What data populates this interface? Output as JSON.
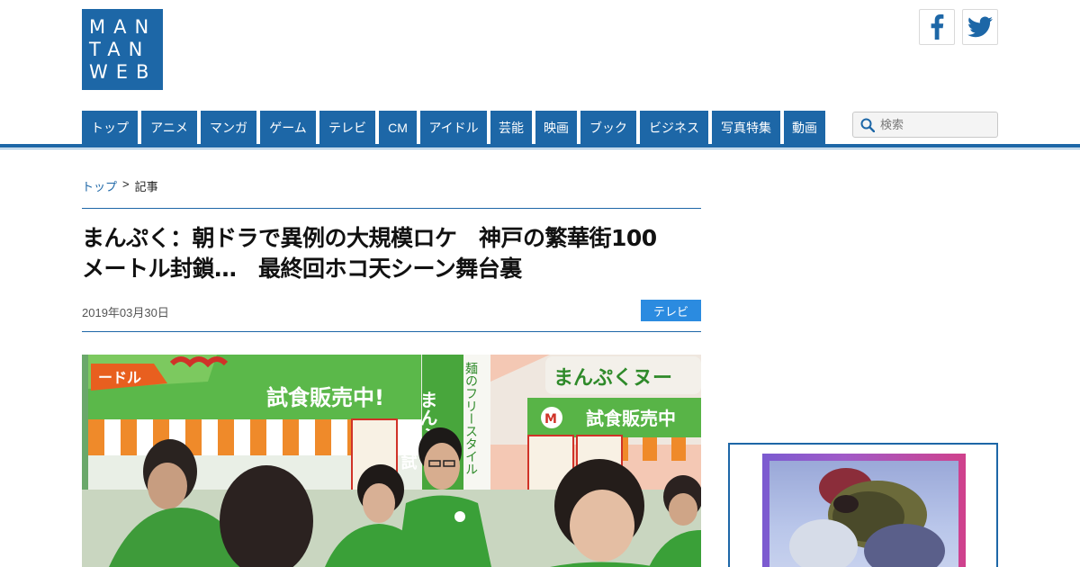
{
  "logo": {
    "lines": [
      "MAN",
      "TAN",
      "WEB"
    ]
  },
  "social": {
    "facebook_icon": "facebook-icon",
    "twitter_icon": "twitter-icon"
  },
  "nav": {
    "items": [
      {
        "label": "トップ",
        "w": 62
      },
      {
        "label": "アニメ",
        "w": 62
      },
      {
        "label": "マンガ",
        "w": 62
      },
      {
        "label": "ゲーム",
        "w": 62
      },
      {
        "label": "テレビ",
        "w": 62
      },
      {
        "label": "CM",
        "w": 42
      },
      {
        "label": "アイドル",
        "w": 74
      },
      {
        "label": "芸能",
        "w": 46
      },
      {
        "label": "映画",
        "w": 46
      },
      {
        "label": "ブック",
        "w": 62
      },
      {
        "label": "ビジネス",
        "w": 76
      },
      {
        "label": "写真特集",
        "w": 76
      },
      {
        "label": "動画",
        "w": 46
      }
    ]
  },
  "search": {
    "placeholder": "検索"
  },
  "breadcrumb": {
    "home": "トップ",
    "separator": ">",
    "current": "記事"
  },
  "article": {
    "title_line1": "まんぷく：朝ドラで異例の大規模ロケ　神戸の繁華街100",
    "title_line2": "メートル封鎖…　最終回ホコ天シーン舞台裏",
    "date": "2019年03月30日",
    "category": "テレビ"
  },
  "photo": {
    "banner_left": "試食販売中!",
    "banner_right_top": "まんぷくヌー",
    "banner_right_bottom": "試食販売中",
    "tag_left": "ードル",
    "pole_text": "まんぷ",
    "pole_text2": "試",
    "stall_vertical": "麺のフリースタイル"
  },
  "colors": {
    "brand": "#1d67a7",
    "tag": "#2b8be0"
  }
}
